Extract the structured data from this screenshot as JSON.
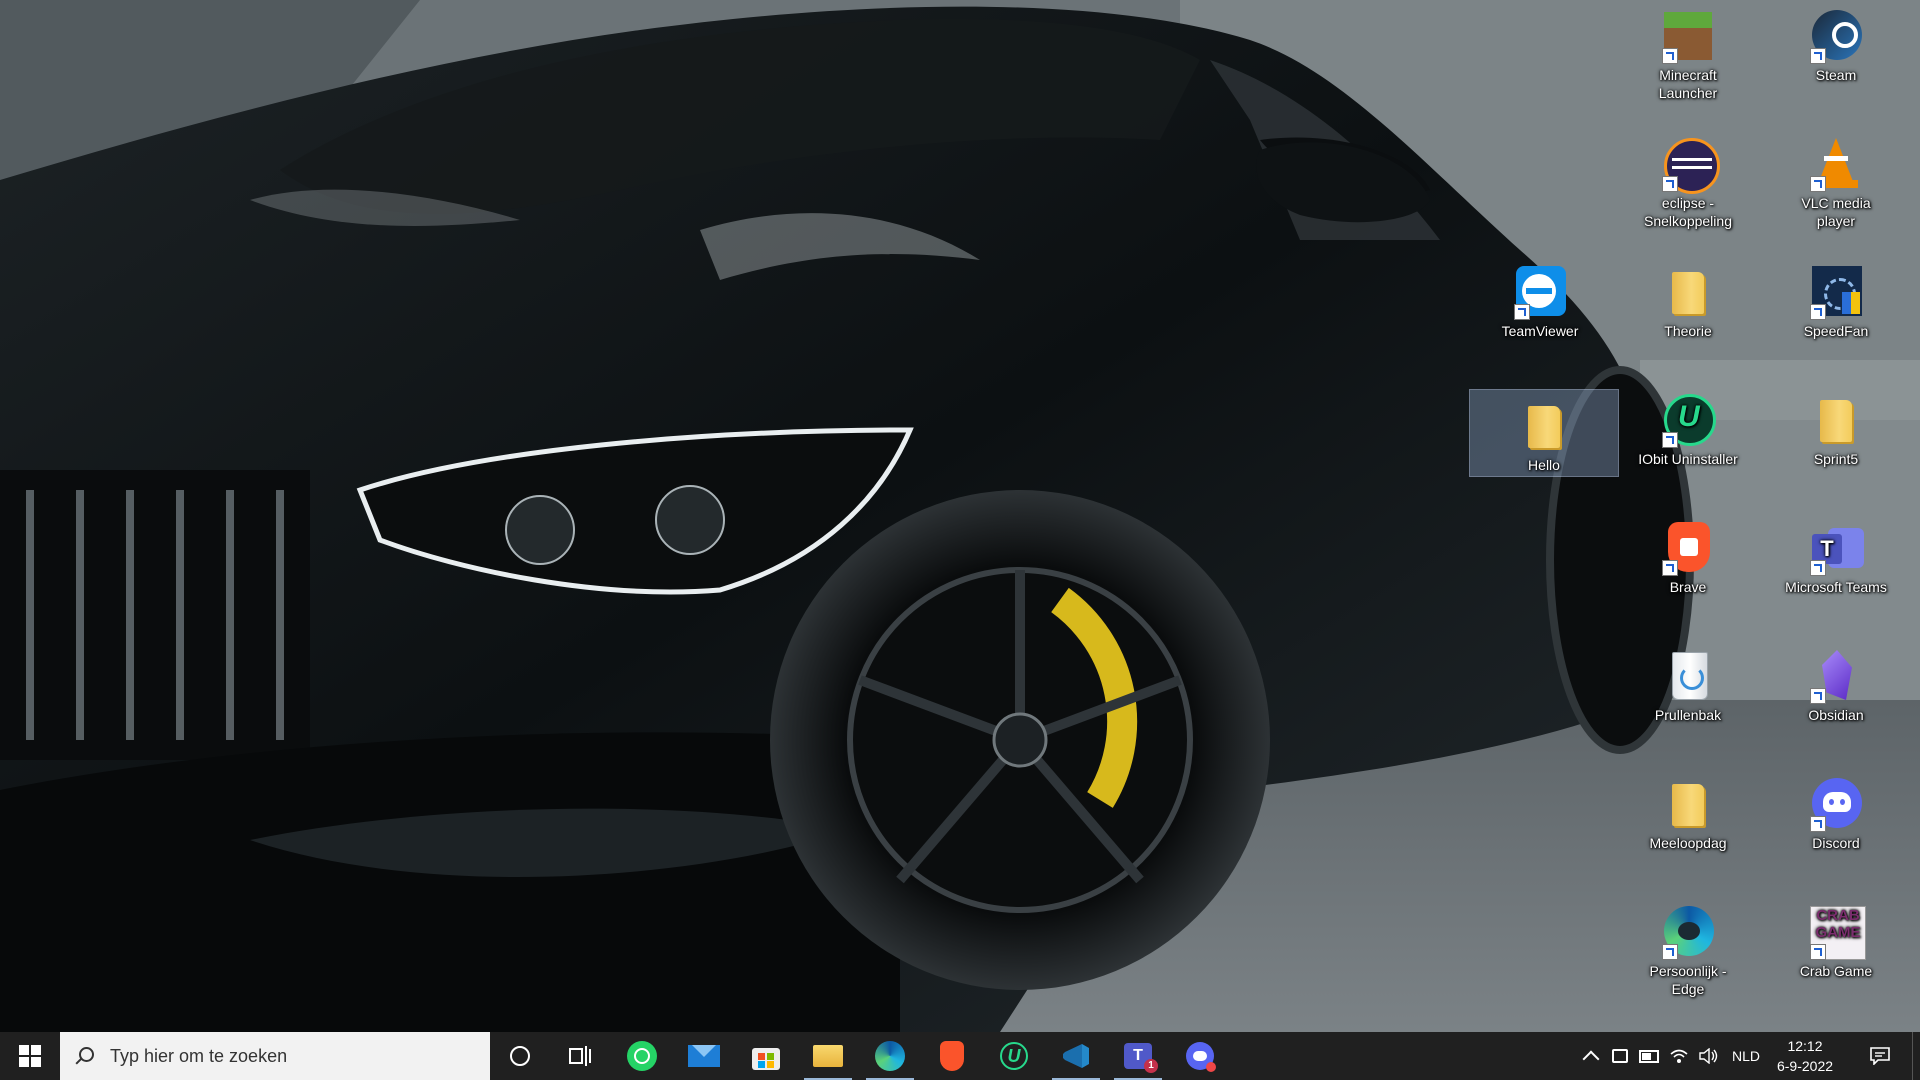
{
  "desktop": {
    "icons": [
      {
        "label": "Minecraft Launcher",
        "icon": "minecraft-grass-block"
      },
      {
        "label": "Steam",
        "icon": "steam-logo"
      },
      {
        "label": "eclipse -\nSnelkoppeling",
        "icon": "eclipse-logo"
      },
      {
        "label": "VLC media player",
        "icon": "vlc-cone"
      },
      {
        "label": "TeamViewer",
        "icon": "teamviewer-logo"
      },
      {
        "label": "Theorie",
        "icon": "folder"
      },
      {
        "label": "SpeedFan",
        "icon": "speedfan-logo"
      },
      {
        "label": "Hello",
        "icon": "folder"
      },
      {
        "label": "IObit Uninstaller",
        "icon": "iobit-uninstaller-logo"
      },
      {
        "label": "Sprint5",
        "icon": "folder"
      },
      {
        "label": "Brave",
        "icon": "brave-lion"
      },
      {
        "label": "Microsoft Teams",
        "icon": "teams-logo"
      },
      {
        "label": "Prullenbak",
        "icon": "recycle-bin"
      },
      {
        "label": "Obsidian",
        "icon": "obsidian-crystal"
      },
      {
        "label": "Meeloopdag",
        "icon": "folder"
      },
      {
        "label": "Discord",
        "icon": "discord-logo"
      },
      {
        "label": "Persoonlijk - Edge",
        "icon": "edge-logo"
      },
      {
        "label": "Crab Game",
        "icon": "crab-game-logo"
      }
    ],
    "selected": "Hello"
  },
  "taskbar": {
    "search_placeholder": "Typ hier om te zoeken",
    "apps": [
      {
        "name": "cortana",
        "icon": "cortana-circle-icon"
      },
      {
        "name": "task-view",
        "icon": "task-view-icon"
      },
      {
        "name": "whatsapp",
        "icon": "whatsapp-icon"
      },
      {
        "name": "mail",
        "icon": "mail-icon"
      },
      {
        "name": "microsoft-store",
        "icon": "store-icon"
      },
      {
        "name": "file-explorer",
        "icon": "folder-icon"
      },
      {
        "name": "edge",
        "icon": "edge-icon"
      },
      {
        "name": "brave",
        "icon": "brave-icon"
      },
      {
        "name": "iobit-uninstaller",
        "icon": "iobit-icon"
      },
      {
        "name": "vscode",
        "icon": "vscode-icon"
      },
      {
        "name": "teams",
        "icon": "teams-icon",
        "badge": "1"
      },
      {
        "name": "discord-ptb",
        "icon": "discord-icon"
      }
    ],
    "tray": {
      "language": "NLD",
      "time": "12:12",
      "date": "6-9-2022"
    }
  },
  "colors": {
    "taskbar_bg": "#202020",
    "search_bg": "#f2f2f2",
    "selection": "#a0bee6"
  }
}
